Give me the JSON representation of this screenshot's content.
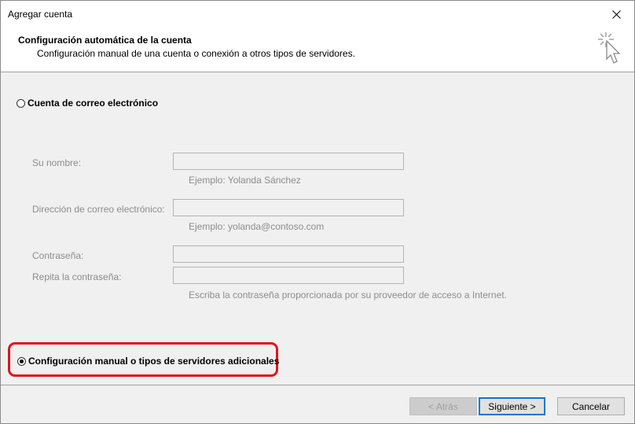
{
  "window": {
    "title": "Agregar cuenta"
  },
  "header": {
    "title": "Configuración automática de la cuenta",
    "subtitle": "Configuración manual de una cuenta o conexión a otros tipos de servidores."
  },
  "options": {
    "email_account": {
      "label": "Cuenta de correo electrónico",
      "checked": false
    },
    "manual_config": {
      "label": "Configuración manual o tipos de servidores adicionales",
      "checked": true
    }
  },
  "form": {
    "name": {
      "label": "Su nombre:",
      "value": "",
      "hint": "Ejemplo: Yolanda Sánchez"
    },
    "email": {
      "label": "Dirección de correo electrónico:",
      "value": "",
      "hint": "Ejemplo: yolanda@contoso.com"
    },
    "password": {
      "label": "Contraseña:",
      "value": ""
    },
    "password_repeat": {
      "label": "Repita la contraseña:",
      "value": ""
    },
    "password_hint": "Escriba la contraseña proporcionada por su proveedor de acceso a Internet."
  },
  "buttons": {
    "back": "< Atrás",
    "next": "Siguiente >",
    "cancel": "Cancelar"
  },
  "colors": {
    "highlight": "#e0151c",
    "default_button_border": "#0078d7"
  },
  "icons": {
    "close": "close-icon",
    "wizard": "cursor-sparkle-icon"
  }
}
